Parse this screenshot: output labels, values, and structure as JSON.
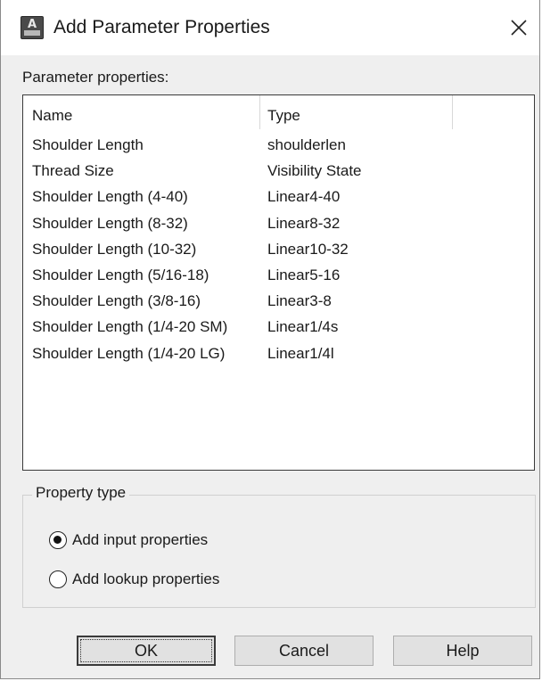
{
  "window": {
    "title": "Add Parameter Properties",
    "icon": "autocad-app-icon",
    "icon_letter": "A"
  },
  "params_label": "Parameter properties:",
  "list": {
    "columns": [
      "Name",
      "Type"
    ],
    "rows": [
      {
        "name": "Shoulder Length",
        "type": "shoulderlen"
      },
      {
        "name": "Thread Size",
        "type": "Visibility State"
      },
      {
        "name": "Shoulder Length (4-40)",
        "type": "Linear4-40"
      },
      {
        "name": "Shoulder Length (8-32)",
        "type": "Linear8-32"
      },
      {
        "name": "Shoulder Length (10-32)",
        "type": "Linear10-32"
      },
      {
        "name": "Shoulder Length (5/16-18)",
        "type": "Linear5-16"
      },
      {
        "name": "Shoulder Length (3/8-16)",
        "type": "Linear3-8"
      },
      {
        "name": "Shoulder Length (1/4-20 SM)",
        "type": "Linear1/4s"
      },
      {
        "name": "Shoulder Length (1/4-20 LG)",
        "type": "Linear1/4l"
      }
    ]
  },
  "property_type": {
    "title": "Property type",
    "options": [
      {
        "label": "Add input properties",
        "selected": true
      },
      {
        "label": "Add lookup properties",
        "selected": false
      }
    ]
  },
  "buttons": {
    "ok": "OK",
    "cancel": "Cancel",
    "help": "Help"
  }
}
